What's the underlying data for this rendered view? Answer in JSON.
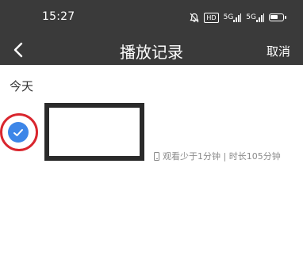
{
  "status_bar": {
    "time": "15:27",
    "hd": "HD",
    "sig1": "5G",
    "sig2": "5G",
    "icons": [
      "mute-bell-icon",
      "hd-icon",
      "signal-icon",
      "signal-icon",
      "battery-icon"
    ]
  },
  "header": {
    "title": "播放记录",
    "cancel_label": "取消",
    "back_icon": "chevron-left-icon"
  },
  "sections": [
    {
      "label": "今天",
      "items": [
        {
          "selected": true,
          "device_icon": "phone-icon",
          "meta": "观看少于1分钟 | 时长105分钟"
        }
      ]
    }
  ],
  "colors": {
    "header_bg": "#3a3a3a",
    "check_blue": "#3d86e8",
    "highlight_red": "#d9262e",
    "meta_gray": "#8a8a8a"
  }
}
